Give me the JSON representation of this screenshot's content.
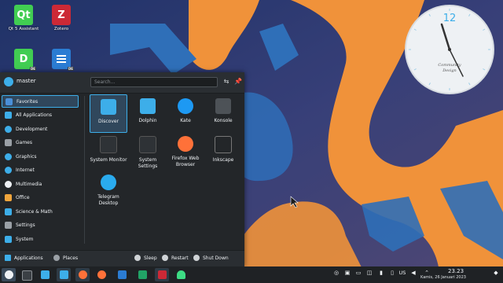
{
  "desktop": {
    "icons": [
      {
        "label": "Qt 5 Assistant",
        "glyph": "Qt",
        "color": "#41cd52"
      },
      {
        "label": "Zotero",
        "glyph": "Z",
        "color": "#cc2936"
      },
      {
        "label": "",
        "glyph": "D",
        "color": "#41cd52",
        "badge": "DE"
      },
      {
        "label": "",
        "glyph": "",
        "color": "#2b7cd3",
        "badge": "DE"
      }
    ]
  },
  "clock_widget": {
    "twelve": "12",
    "brand_line1": "Community",
    "brand_line2": "Design"
  },
  "launcher": {
    "user_name": "master",
    "search_placeholder": "Search...",
    "categories": [
      {
        "label": "Favorites",
        "icon": "star-icon",
        "color": "#4a90d9"
      },
      {
        "label": "All Applications",
        "icon": "grid-icon",
        "color": "#3daee9"
      },
      {
        "label": "Development",
        "icon": "code-icon",
        "color": "#3daee9"
      },
      {
        "label": "Games",
        "icon": "gamepad-icon",
        "color": "#9aa0a6"
      },
      {
        "label": "Graphics",
        "icon": "palette-icon",
        "color": "#3daee9"
      },
      {
        "label": "Internet",
        "icon": "globe-icon",
        "color": "#3daee9"
      },
      {
        "label": "Multimedia",
        "icon": "media-icon",
        "color": "#eef1f4"
      },
      {
        "label": "Office",
        "icon": "office-icon",
        "color": "#f0a53c"
      },
      {
        "label": "Science & Math",
        "icon": "atom-icon",
        "color": "#3daee9"
      },
      {
        "label": "Settings",
        "icon": "settings-icon",
        "color": "#9aa0a6"
      },
      {
        "label": "System",
        "icon": "system-icon",
        "color": "#3daee9"
      }
    ],
    "apps": [
      {
        "label": "Discover",
        "icon": "discover-icon",
        "color": "#3daee9"
      },
      {
        "label": "Dolphin",
        "icon": "folder-icon",
        "color": "#3daee9"
      },
      {
        "label": "Kate",
        "icon": "kate-icon",
        "color": "#1d99f3"
      },
      {
        "label": "Konsole",
        "icon": "terminal-icon",
        "color": "#4d5257"
      },
      {
        "label": "System Monitor",
        "icon": "monitor-icon",
        "color": "#2e3236"
      },
      {
        "label": "System Settings",
        "icon": "sliders-icon",
        "color": "#2e3236"
      },
      {
        "label": "Firefox Web Browser",
        "icon": "firefox-icon",
        "color": "#ff7139"
      },
      {
        "label": "Inkscape",
        "icon": "inkscape-icon",
        "color": "#232629"
      },
      {
        "label": "Telegram Desktop",
        "icon": "telegram-icon",
        "color": "#2aabee"
      }
    ],
    "footer": {
      "applications": "Applications",
      "places": "Places",
      "sleep": "Sleep",
      "restart": "Restart",
      "shutdown": "Shut Down"
    }
  },
  "taskbar": {
    "tasks": [
      {
        "name": "terminal",
        "color": "#3b4045"
      },
      {
        "name": "files",
        "color": "#3daee9"
      },
      {
        "name": "dolphin",
        "color": "#3daee9"
      },
      {
        "name": "firefox",
        "color": "#ff7139"
      },
      {
        "name": "firefox",
        "color": "#ff7139"
      },
      {
        "name": "document",
        "color": "#2b7cd3"
      },
      {
        "name": "spreadsheet",
        "color": "#21a366"
      },
      {
        "name": "zotero",
        "color": "#cc2936"
      },
      {
        "name": "android",
        "color": "#3ddc84"
      }
    ],
    "keyboard_layout": "US",
    "time": "23.23",
    "date": "Kamis, 26 Januari 2023"
  },
  "colors": {
    "accent": "#3daee9",
    "panel": "#232629",
    "wallpaper_sky": "#2a3f7e",
    "wallpaper_orange": "#f0923a",
    "wallpaper_blue": "#2f6fb8"
  }
}
